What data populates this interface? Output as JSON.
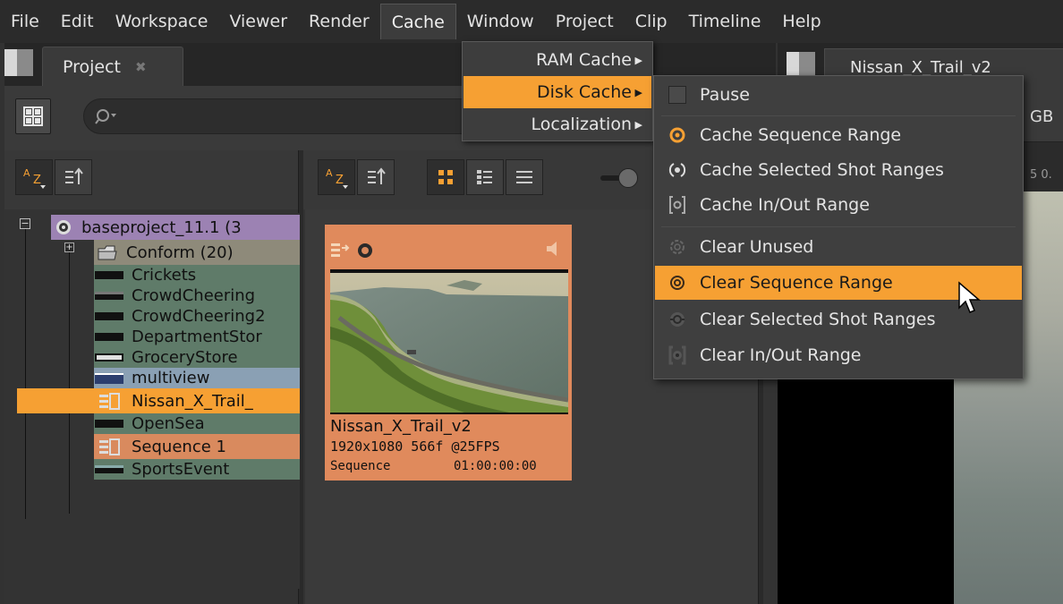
{
  "menubar": {
    "items": [
      "File",
      "Edit",
      "Workspace",
      "Viewer",
      "Render",
      "Cache",
      "Window",
      "Project",
      "Clip",
      "Timeline",
      "Help"
    ],
    "open_menu": "Cache"
  },
  "project_panel": {
    "tab_label": "Project",
    "tab_close": "✖"
  },
  "toolbar": {
    "sort_label": "A Z",
    "sort_label_small": "A"
  },
  "tree": {
    "root": "baseproject_11.1 (3",
    "folder": "Conform (20)",
    "items": [
      {
        "label": "Crickets",
        "type": "clip",
        "color": "#5f7b69"
      },
      {
        "label": "CrowdCheering",
        "type": "clip",
        "color": "#5f7b69"
      },
      {
        "label": "CrowdCheering2",
        "type": "clip",
        "color": "#5f7b69"
      },
      {
        "label": "DepartmentStor",
        "type": "clip",
        "color": "#5f7b69"
      },
      {
        "label": "GroceryStore",
        "type": "clip",
        "color": "#5f7b69"
      },
      {
        "label": "multiview",
        "type": "multiview",
        "color": "#8aa0b4"
      },
      {
        "label": "Nissan_X_Trail_",
        "type": "sequence",
        "color": "#f6a033"
      },
      {
        "label": "OpenSea",
        "type": "clip",
        "color": "#5f7b69"
      },
      {
        "label": "Sequence 1",
        "type": "sequence",
        "color": "#d98a5e"
      },
      {
        "label": "SportsEvent",
        "type": "clip",
        "color": "#5f7b69"
      }
    ]
  },
  "thumbnail": {
    "name": "Nissan_X_Trail_v2",
    "info": "1920x1080 566f @25FPS",
    "type": "Sequence",
    "timecode": "01:00:00:00"
  },
  "viewer": {
    "tab_label": "Nissan_X_Trail_v2",
    "gb_label": "GB",
    "ruler_text": "5 0."
  },
  "cache_menu": {
    "items": [
      {
        "label": "RAM Cache",
        "active": false
      },
      {
        "label": "Disk Cache",
        "active": true
      },
      {
        "label": "Localization",
        "active": false
      }
    ]
  },
  "disk_cache_menu": {
    "items": [
      {
        "label": "Pause",
        "icon": "checkbox-icon",
        "active": false
      },
      {
        "label": "Cache Sequence Range",
        "icon": "cache-sequence-icon",
        "active": false
      },
      {
        "label": "Cache Selected Shot Ranges",
        "icon": "cache-shots-icon",
        "active": false
      },
      {
        "label": "Cache In/Out Range",
        "icon": "cache-inout-icon",
        "active": false
      },
      {
        "label": "Clear Unused",
        "icon": "clear-unused-icon",
        "active": false
      },
      {
        "label": "Clear Sequence Range",
        "icon": "clear-sequence-icon",
        "active": true
      },
      {
        "label": "Clear Selected Shot Ranges",
        "icon": "clear-shots-icon",
        "active": false
      },
      {
        "label": "Clear In/Out Range",
        "icon": "clear-inout-icon",
        "active": false
      }
    ]
  },
  "colors": {
    "accent": "#f6a033",
    "clip_row": "#5f7b69",
    "sequence_row": "#d98a5e"
  }
}
